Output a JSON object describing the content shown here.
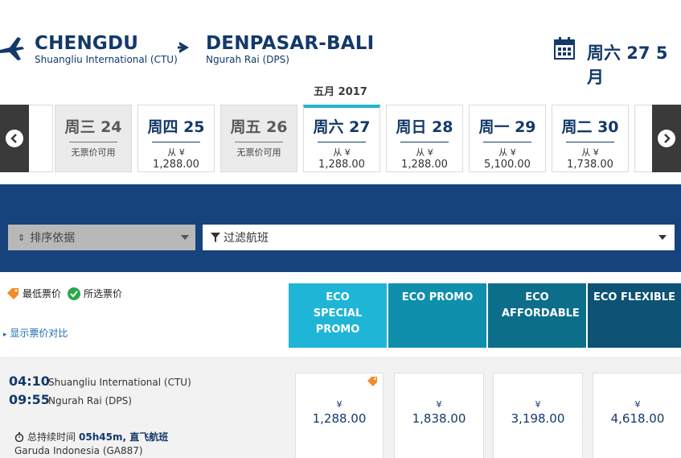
{
  "header": {
    "origin_city": "CHENGDU",
    "origin_airport": "Shuangliu International (CTU)",
    "dest_city": "DENPASAR-BALI",
    "dest_airport": "Ngurah Rai (DPS)",
    "selected_date": "周六 27 5月"
  },
  "month_label": "五月 2017",
  "dates": [
    {
      "label": "周三 24",
      "available": false,
      "na_text": "无票价可用"
    },
    {
      "label": "周四 25",
      "available": true,
      "from": "从 ¥",
      "price": "1,288.00"
    },
    {
      "label": "周五 26",
      "available": false,
      "na_text": "无票价可用"
    },
    {
      "label": "周六 27",
      "available": true,
      "from": "从 ¥",
      "price": "1,288.00",
      "active": true
    },
    {
      "label": "周日 28",
      "available": true,
      "from": "从 ¥",
      "price": "1,288.00"
    },
    {
      "label": "周一 29",
      "available": true,
      "from": "从 ¥",
      "price": "5,100.00"
    },
    {
      "label": "周二 30",
      "available": true,
      "from": "从 ¥",
      "price": "1,738.00"
    }
  ],
  "controls": {
    "sort_label": "排序依据",
    "filter_label": "过滤航班"
  },
  "legend": {
    "lowest": "最低票价",
    "selected": "所选票价",
    "compare_link": "显示票价对比"
  },
  "fares": [
    {
      "name": "ECO SPECIAL PROMO",
      "color": "#1fb5d6"
    },
    {
      "name": "ECO PROMO",
      "color": "#0f8fab"
    },
    {
      "name": "ECO AFFORDABLE",
      "color": "#0d6e8a"
    },
    {
      "name": "ECO FLEXIBLE",
      "color": "#0e5274"
    }
  ],
  "flight": {
    "depart_time": "04:10",
    "depart_airport": "Shuangliu International (CTU)",
    "arrive_time": "09:55",
    "arrive_airport": "Ngurah Rai (DPS)",
    "duration_label": "总持续时间",
    "duration": "05h45m, 直飞航班",
    "airline": "Garuda Indonesia (GA887)",
    "currency": "¥",
    "prices": [
      "1,288.00",
      "1,838.00",
      "3,198.00",
      "4,618.00"
    ]
  },
  "colors": {
    "band": "#16437c",
    "accent": "#1fb5c9",
    "lowest_tag": "#f28c28",
    "selected_check": "#2aa84a"
  }
}
